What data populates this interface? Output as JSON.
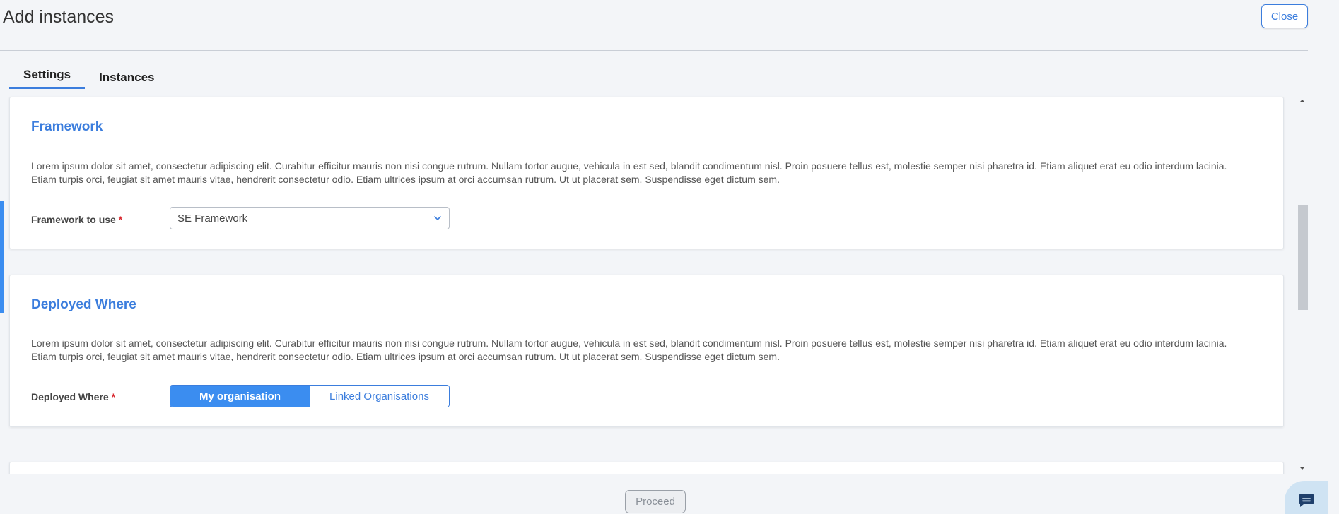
{
  "page": {
    "title": "Add instances"
  },
  "header": {
    "close_label": "Close"
  },
  "tabs": [
    {
      "label": "Settings",
      "active": true
    },
    {
      "label": "Instances",
      "active": false
    }
  ],
  "sections": {
    "framework": {
      "title": "Framework",
      "description": "Lorem ipsum dolor sit amet, consectetur adipiscing elit. Curabitur efficitur mauris non nisi congue rutrum. Nullam tortor augue, vehicula in est sed, blandit condimentum nisl. Proin posuere tellus est, molestie semper nisi pharetra id. Etiam aliquet erat eu odio interdum lacinia. Etiam turpis orci, feugiat sit amet mauris vitae, hendrerit consectetur odio. Etiam ultrices ipsum at orci accumsan rutrum. Ut ut placerat sem. Suspendisse eget dictum sem.",
      "field_label": "Framework to use",
      "required_mark": "*",
      "selected_value": "SE Framework"
    },
    "deployed_where": {
      "title": "Deployed Where",
      "description": "Lorem ipsum dolor sit amet, consectetur adipiscing elit. Curabitur efficitur mauris non nisi congue rutrum. Nullam tortor augue, vehicula in est sed, blandit condimentum nisl. Proin posuere tellus est, molestie semper nisi pharetra id. Etiam aliquet erat eu odio interdum lacinia. Etiam turpis orci, feugiat sit amet mauris vitae, hendrerit consectetur odio. Etiam ultrices ipsum at orci accumsan rutrum. Ut ut placerat sem. Suspendisse eget dictum sem.",
      "field_label": "Deployed Where",
      "required_mark": "*",
      "options": [
        "My organisation",
        "Linked Organisations"
      ],
      "selected": "My organisation"
    }
  },
  "footer": {
    "proceed_label": "Proceed",
    "proceed_enabled": false
  },
  "icons": {
    "dropdown": "chevron-down-icon",
    "chat": "chat-bubble-icon",
    "scroll_up": "scroll-up-arrow-icon",
    "scroll_down": "scroll-down-arrow-icon"
  },
  "colors": {
    "accent": "#3b7ddd",
    "toggle_active": "#3b8df0",
    "required": "#d9282f",
    "background": "#f3f5f8"
  }
}
